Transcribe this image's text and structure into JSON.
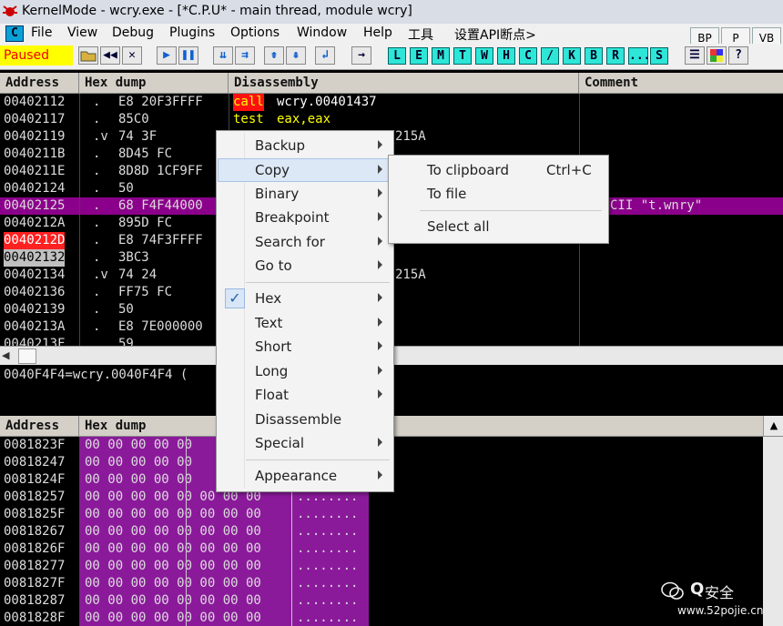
{
  "window": {
    "title": "KernelMode - wcry.exe - [*C.P.U* - main thread, module wcry]"
  },
  "menubar": {
    "c_icon": "C",
    "items": [
      "File",
      "View",
      "Debug",
      "Plugins",
      "Options",
      "Window",
      "Help",
      "工具",
      "设置API断点>"
    ],
    "right_buttons": [
      "BP",
      "P",
      "VB"
    ]
  },
  "toolbar": {
    "status": "Paused",
    "letter_buttons": [
      "L",
      "E",
      "M",
      "T",
      "W",
      "H",
      "C",
      "/",
      "K",
      "B",
      "R",
      "...",
      "S"
    ]
  },
  "cpu": {
    "headers": {
      "address": "Address",
      "hex": "Hex dump",
      "disasm": "Disassembly",
      "comment": "Comment"
    },
    "rows": [
      {
        "addr": "00402112",
        "mark": ".",
        "hex": "E8 20F3FFFF",
        "op": "call",
        "args": "wcry.00401437",
        "comment": ""
      },
      {
        "addr": "00402117",
        "mark": ".",
        "hex": "85C0",
        "op": "test",
        "args": "eax,eax",
        "comment": ""
      },
      {
        "addr": "00402119",
        "mark": ".v",
        "hex": "74 3F",
        "op": "",
        "args": "215A",
        "comment": ""
      },
      {
        "addr": "0040211B",
        "mark": ".",
        "hex": "8D45 FC",
        "op": "",
        "args": "",
        "comment": ""
      },
      {
        "addr": "0040211E",
        "mark": ".",
        "hex": "8D8D 1CF9FF",
        "op": "",
        "args": "",
        "comment": ""
      },
      {
        "addr": "00402124",
        "mark": ".",
        "hex": "50",
        "op": "",
        "args": "",
        "comment": ""
      },
      {
        "addr": "00402125",
        "mark": ".",
        "hex": "68 F4F44000",
        "op": "",
        "args": "",
        "comment": "CII \"t.wnry\""
      },
      {
        "addr": "0040212A",
        "mark": ".",
        "hex": "895D FC",
        "op": "",
        "args": "",
        "comment": ""
      },
      {
        "addr": "0040212D",
        "mark": ".",
        "hex": "E8 74F3FFFF",
        "op": "",
        "args": "",
        "comment": ""
      },
      {
        "addr": "00402132",
        "mark": ".",
        "hex": "3BC3",
        "op": "",
        "args": "",
        "comment": ""
      },
      {
        "addr": "00402134",
        "mark": ".v",
        "hex": "74 24",
        "op": "",
        "args": "215A",
        "comment": ""
      },
      {
        "addr": "00402136",
        "mark": ".",
        "hex": "FF75 FC",
        "op": "",
        "args": "",
        "comment": ""
      },
      {
        "addr": "00402139",
        "mark": ".",
        "hex": "50",
        "op": "",
        "args": "",
        "comment": ""
      },
      {
        "addr": "0040213A",
        "mark": ".",
        "hex": "E8 7E000000",
        "op": "",
        "args": "",
        "comment": ""
      }
    ],
    "partial_row": {
      "addr": "0040213F",
      "hex": "59"
    },
    "info_line": "0040F4F4=wcry.0040F4F4 ("
  },
  "dump": {
    "headers": {
      "address": "Address",
      "hex": "Hex dump"
    },
    "rows": [
      {
        "addr": "0081823F",
        "bytes": "00 00 00 00 00",
        "ascii": ""
      },
      {
        "addr": "00818247",
        "bytes": "00 00 00 00 00",
        "ascii": ""
      },
      {
        "addr": "0081824F",
        "bytes": "00 00 00 00 00",
        "ascii": ""
      },
      {
        "addr": "00818257",
        "bytes": "00 00 00 00 00 00 00 00",
        "ascii": "........"
      },
      {
        "addr": "0081825F",
        "bytes": "00 00 00 00 00 00 00 00",
        "ascii": "........"
      },
      {
        "addr": "00818267",
        "bytes": "00 00 00 00 00 00 00 00",
        "ascii": "........"
      },
      {
        "addr": "0081826F",
        "bytes": "00 00 00 00 00 00 00 00",
        "ascii": "........"
      },
      {
        "addr": "00818277",
        "bytes": "00 00 00 00 00 00 00 00",
        "ascii": "........"
      },
      {
        "addr": "0081827F",
        "bytes": "00 00 00 00 00 00 00 00",
        "ascii": "........"
      },
      {
        "addr": "00818287",
        "bytes": "00 00 00 00 00 00 00 00",
        "ascii": "........"
      },
      {
        "addr": "0081828F",
        "bytes": "00 00 00 00 00 00 00 00",
        "ascii": "........"
      }
    ]
  },
  "context_menu": {
    "items": [
      {
        "label": "Backup",
        "submenu": true
      },
      {
        "label": "Copy",
        "submenu": true,
        "highlighted": true
      },
      {
        "label": "Binary",
        "submenu": true
      },
      {
        "label": "Breakpoint",
        "submenu": true
      },
      {
        "label": "Search for",
        "submenu": true
      },
      {
        "label": "Go to",
        "submenu": true
      },
      {
        "label": "Hex",
        "submenu": true,
        "checked": true
      },
      {
        "label": "Text",
        "submenu": true
      },
      {
        "label": "Short",
        "submenu": true
      },
      {
        "label": "Long",
        "submenu": true
      },
      {
        "label": "Float",
        "submenu": true
      },
      {
        "label": "Disassemble",
        "submenu": false
      },
      {
        "label": "Special",
        "submenu": true
      },
      {
        "label": "Appearance",
        "submenu": true
      }
    ]
  },
  "copy_submenu": {
    "items": [
      {
        "label": "To clipboard",
        "shortcut": "Ctrl+C"
      },
      {
        "label": "To file",
        "shortcut": ""
      },
      {
        "label": "Select all",
        "shortcut": ""
      }
    ]
  },
  "watermark": {
    "brand": "Q",
    "text": "安全",
    "url": "www.52pojie.cn"
  },
  "colors": {
    "highlight_row": "#8b008b",
    "call_bg": "#ff1010",
    "test_fg": "#ffff00",
    "dump_bg": "#8b1a9b",
    "bp_addr_bg": "#ff2020",
    "current_addr_bg": "#c0c0c0"
  }
}
